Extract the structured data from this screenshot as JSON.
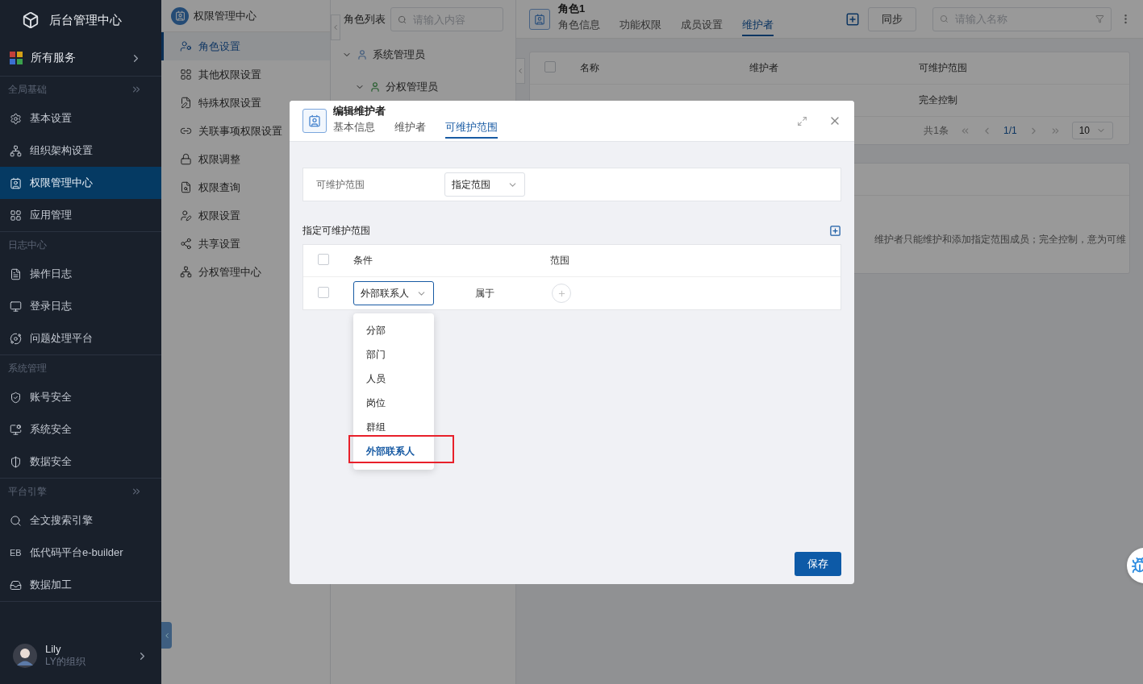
{
  "app": {
    "title": "后台管理中心"
  },
  "sidebar": {
    "all_services": "所有服务",
    "sections": [
      {
        "title": "全局基础",
        "expandable": true,
        "items": [
          {
            "label": "基本设置",
            "selected": false
          },
          {
            "label": "组织架构设置",
            "selected": false
          },
          {
            "label": "权限管理中心",
            "selected": true
          },
          {
            "label": "应用管理",
            "selected": false
          }
        ]
      },
      {
        "title": "日志中心",
        "expandable": false,
        "items": [
          {
            "label": "操作日志",
            "selected": false
          },
          {
            "label": "登录日志",
            "selected": false
          },
          {
            "label": "问题处理平台",
            "selected": false
          }
        ]
      },
      {
        "title": "系统管理",
        "expandable": false,
        "items": [
          {
            "label": "账号安全",
            "selected": false
          },
          {
            "label": "系统安全",
            "selected": false
          },
          {
            "label": "数据安全",
            "selected": false
          }
        ]
      },
      {
        "title": "平台引擎",
        "expandable": true,
        "items": [
          {
            "label": "全文搜索引擎",
            "selected": false
          },
          {
            "label": "低代码平台e-builder",
            "icon_text": "EB",
            "selected": false
          },
          {
            "label": "数据加工",
            "selected": false
          }
        ]
      }
    ],
    "user": {
      "name": "Lily",
      "org": "LY的组织"
    }
  },
  "submenu": {
    "title": "权限管理中心",
    "items": [
      {
        "label": "角色设置",
        "selected": true
      },
      {
        "label": "其他权限设置",
        "selected": false
      },
      {
        "label": "特殊权限设置",
        "selected": false
      },
      {
        "label": "关联事项权限设置",
        "selected": false
      },
      {
        "label": "权限调整",
        "selected": false
      },
      {
        "label": "权限查询",
        "selected": false
      },
      {
        "label": "权限设置",
        "selected": false
      },
      {
        "label": "共享设置",
        "selected": false
      },
      {
        "label": "分权管理中心",
        "selected": false
      }
    ]
  },
  "role_list": {
    "title": "角色列表",
    "search": {
      "placeholder": "请输入内容"
    },
    "tree": [
      {
        "label": "系统管理员",
        "expanded": true,
        "children": [
          {
            "label": "分权管理员",
            "expanded": true
          }
        ]
      }
    ]
  },
  "role": {
    "title": "角色1",
    "tabs": [
      {
        "label": "角色信息",
        "selected": false
      },
      {
        "label": "功能权限",
        "selected": false
      },
      {
        "label": "成员设置",
        "selected": false
      },
      {
        "label": "维护者",
        "selected": true
      }
    ],
    "sync_button": "同步",
    "search": {
      "placeholder": "请输入名称"
    },
    "table": {
      "columns": [
        "名称",
        "维护者",
        "可维护范围"
      ],
      "all_checked": false,
      "rows": [
        {
          "scope": "完全控制"
        }
      ]
    },
    "pagination": {
      "total": "共1条",
      "page": "1/1",
      "page_size": "10"
    },
    "note": "维护者只能维护和添加指定范围成员；完全控制，意为可维"
  },
  "dialog": {
    "title": "编辑维护者",
    "tabs": [
      {
        "label": "基本信息",
        "selected": false
      },
      {
        "label": "维护者",
        "selected": false
      },
      {
        "label": "可维护范围",
        "selected": true
      }
    ],
    "scope_field": {
      "label": "可维护范围",
      "value": "指定范围"
    },
    "section_title": "指定可维护范围",
    "table": {
      "columns": [
        "条件",
        "范围"
      ],
      "all_checked": false,
      "rows": [
        {
          "checked": false,
          "condition": "外部联系人",
          "relation": "属于"
        }
      ]
    },
    "dropdown": {
      "open": true,
      "options": [
        {
          "label": "分部",
          "selected": false,
          "marked": false
        },
        {
          "label": "部门",
          "selected": false,
          "marked": false
        },
        {
          "label": "人员",
          "selected": false,
          "marked": false
        },
        {
          "label": "岗位",
          "selected": false,
          "marked": false
        },
        {
          "label": "群组",
          "selected": false,
          "marked": false
        },
        {
          "label": "外部联系人",
          "selected": true,
          "marked": true
        }
      ]
    },
    "save_button": "保存"
  }
}
